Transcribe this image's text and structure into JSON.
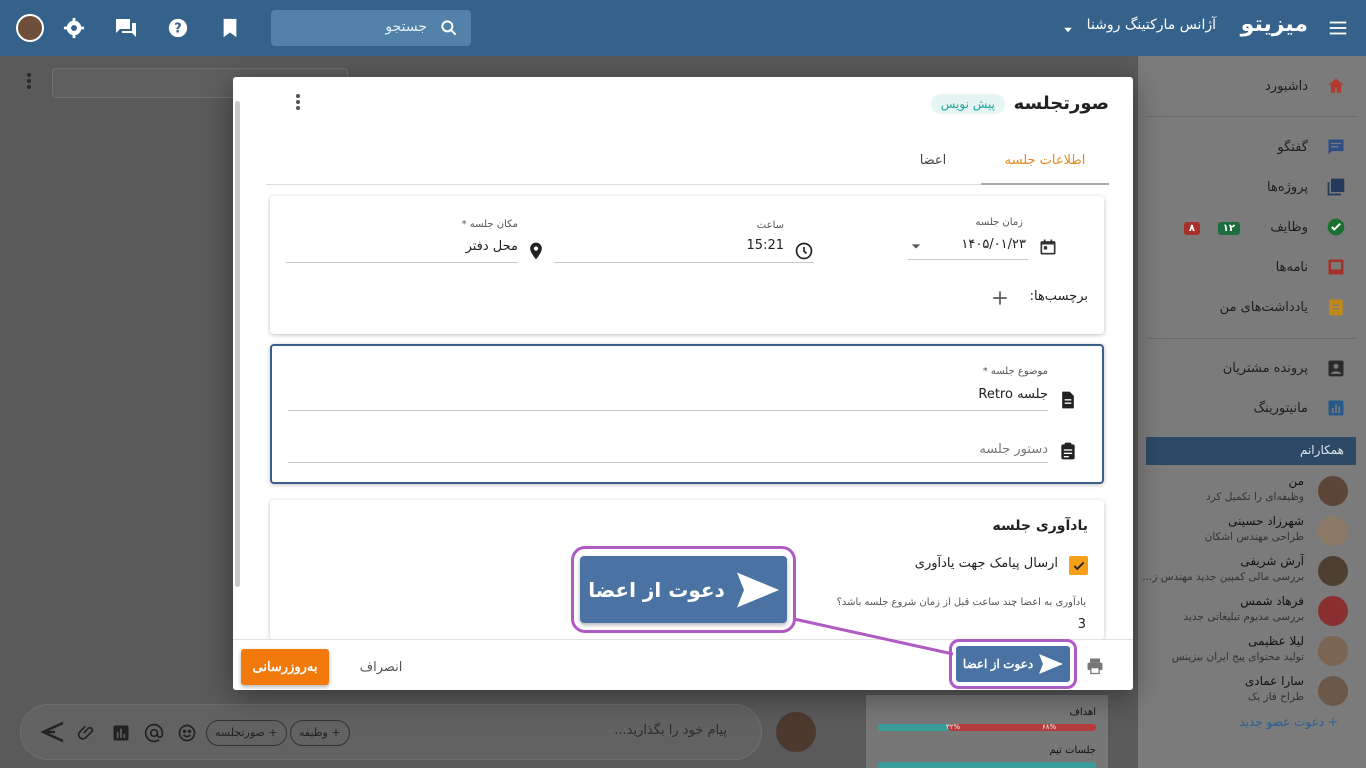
{
  "topbar": {
    "brand": "میزیتو",
    "company": "آژانس مارکتینگ روشنا",
    "search_placeholder": "جستجو"
  },
  "sidebar": {
    "items": [
      {
        "label": "داشبورد",
        "icon": "home-icon",
        "color": "#c0392b"
      },
      {
        "label": "گفتگو",
        "icon": "chat-icon",
        "color": "#3b5fa8"
      },
      {
        "label": "پروژه‌ها",
        "icon": "projects-icon",
        "color": "#2f4f7a"
      },
      {
        "label": "وظایف",
        "icon": "tasks-icon",
        "color": "#1e8a3c"
      },
      {
        "label": "نامه‌ها",
        "icon": "letters-icon",
        "color": "#c0392b"
      },
      {
        "label": "یادداشت‌های من",
        "icon": "notes-icon",
        "color": "#e0a21c"
      },
      {
        "label": "پرونده مشتریان",
        "icon": "clients-icon",
        "color": "#333333"
      },
      {
        "label": "مانیتورینگ",
        "icon": "monitoring-icon",
        "color": "#2f6fb0"
      }
    ],
    "task_badges": {
      "green": "۱۲",
      "red": "۸"
    },
    "colleagues_title": "همکارانم",
    "members": [
      {
        "name": "من",
        "desc": "وظیفه‌ای را تکمیل کرد"
      },
      {
        "name": "شهرزاد حسینی",
        "desc": "طراحی مهندس اشکان"
      },
      {
        "name": "آرش شریفی",
        "desc": "بررسی مالی کمپین جدید مهندس ز..."
      },
      {
        "name": "فرهاد شمس",
        "desc": "بررسی مدیوم تبلیغاتی جدید"
      },
      {
        "name": "لیلا عظیمی",
        "desc": "تولید محتوای پیج ایران بیزینس"
      },
      {
        "name": "سارا عمادی",
        "desc": "طراح فاز یک"
      }
    ],
    "invite_member": "دعوت عضو جدید"
  },
  "chat": {
    "placeholder": "پیام خود را بگذارید...",
    "pill_task": "+ وظیفه",
    "pill_minutes": "+ صورتجلسه"
  },
  "stats": {
    "goals_label": "اهداف",
    "goals_red_pct": "۶۸%",
    "goals_teal_pct": "۳۲%",
    "goals_red_frac": 0.68,
    "meetings_label": "جلسات تیم"
  },
  "modal": {
    "title": "صورتجلسه",
    "status_chip": "پیش نویس",
    "tabs": [
      "اطلاعات جلسه",
      "اعضا"
    ],
    "date_label": "زمان جلسه",
    "date_value": "۱۴۰۵/۰۱/۲۳",
    "time_label": "ساعت",
    "time_value": "15:21",
    "location_label": "مکان جلسه *",
    "location_value": "محل دفتر",
    "tags_label": "برچسب‌ها:",
    "subject_label": "موضوع جلسه *",
    "subject_value": "جلسه Retro",
    "agenda_placeholder": "دستور جلسه",
    "reminder_title": "یادآوری جلسه",
    "reminder_sms": "ارسال پیامک جهت یادآوری",
    "reminder_question": "یادآوری به اعضا چند ساعت قبل از زمان شروع جلسه باشد؟",
    "reminder_hours": "3",
    "btn_update": "به‌روزرسانی",
    "btn_cancel": "انصراف",
    "btn_invite": "دعوت از اعضا"
  },
  "callout": {
    "label": "دعوت از اعضا"
  }
}
